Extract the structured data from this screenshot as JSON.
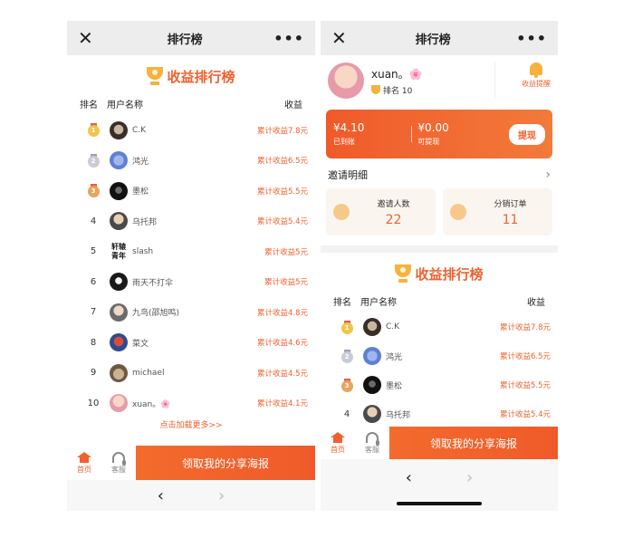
{
  "topbar": {
    "title": "排行榜",
    "close": "✕",
    "more": "•••"
  },
  "ranking": {
    "title": "收益排行榜",
    "headers": {
      "rank": "排名",
      "user": "用户名称",
      "earnings": "收益"
    },
    "rows": [
      {
        "rank": "1",
        "name": "C.K",
        "earnings": "累计收益7.8元"
      },
      {
        "rank": "2",
        "name": "鸿光",
        "earnings": "累计收益6.5元"
      },
      {
        "rank": "3",
        "name": "墨松",
        "earnings": "累计收益5.5元"
      },
      {
        "rank": "4",
        "name": "乌托邦",
        "earnings": "累计收益5.4元"
      },
      {
        "rank": "5",
        "name": "slash",
        "avatar_text": "轩辕 青年",
        "earnings": "累计收益5元"
      },
      {
        "rank": "6",
        "name": "雨天不打伞",
        "earnings": "累计收益5元"
      },
      {
        "rank": "7",
        "name": "九鸟(邵旭鸣)",
        "earnings": "累计收益4.8元"
      },
      {
        "rank": "8",
        "name": "菜文",
        "earnings": "累计收益4.6元"
      },
      {
        "rank": "9",
        "name": "michael",
        "earnings": "累计收益4.5元"
      },
      {
        "rank": "10",
        "name": "xuan。🌸",
        "earnings": "累计收益4.1元"
      }
    ],
    "load_more": "点击加载更多>>"
  },
  "bottom_bar": {
    "home": "首页",
    "service": "客服",
    "poster_button": "领取我的分享海报"
  },
  "nav": {
    "back": "‹",
    "forward": "›"
  },
  "profile": {
    "name": "xuan。🌸",
    "rank_text": "排名 10",
    "reminder": "收益提醒"
  },
  "wallet": {
    "arrived_amount": "¥4.10",
    "arrived_label": "已到账",
    "withdrawable_amount": "¥0.00",
    "withdrawable_label": "可提现",
    "withdraw_button": "提现"
  },
  "invite": {
    "title": "邀请明细",
    "chevron": "›",
    "invite_count_label": "邀请人数",
    "invite_count": "22",
    "orders_label": "分销订单",
    "orders_count": "11"
  },
  "colors": {
    "accent": "#f0612f",
    "gold": "#f6b23d"
  }
}
